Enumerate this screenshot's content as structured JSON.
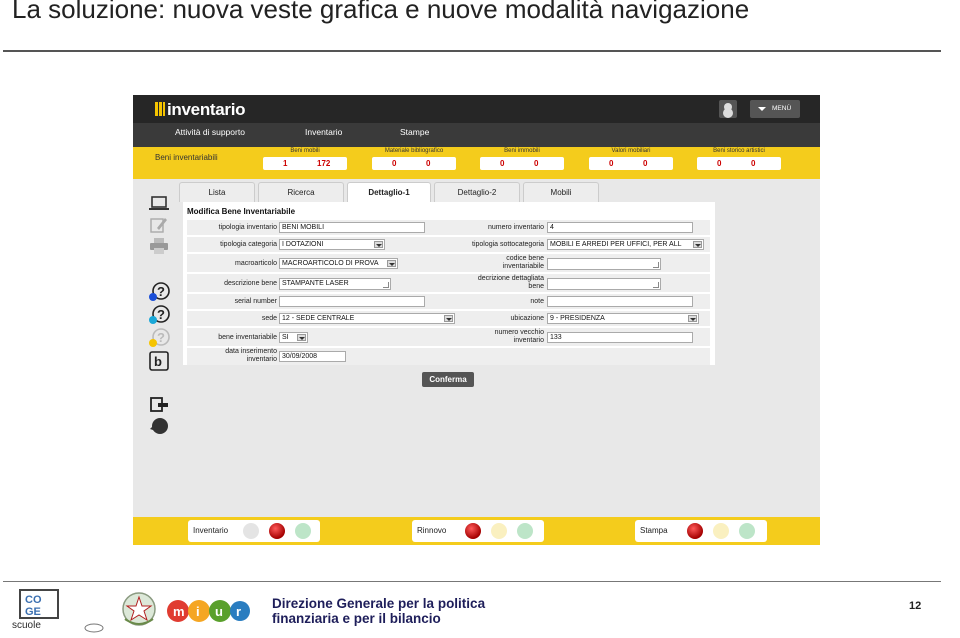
{
  "slide": {
    "title": "La soluzione: nuova veste grafica e nuove modalità navigazione",
    "footer_line1": "Direzione Generale per la politica",
    "footer_line2": "finanziaria e per il bilancio",
    "page_number": "12",
    "coge_logo_text": "scuole"
  },
  "app": {
    "logo": "inventario",
    "menu_label": "MENÙ",
    "nav": [
      "Attività di supporto",
      "Inventario",
      "Stampe"
    ],
    "summary_label": "Beni inventariabili",
    "summary": [
      {
        "label": "Beni mobili",
        "v1": "1",
        "v2": "172"
      },
      {
        "label": "Materiale bibliografico",
        "v1": "0",
        "v2": "0"
      },
      {
        "label": "Beni immobili",
        "v1": "0",
        "v2": "0"
      },
      {
        "label": "Valori mobiliari",
        "v1": "0",
        "v2": "0"
      },
      {
        "label": "Beni storico artistici",
        "v1": "0",
        "v2": "0"
      }
    ],
    "tabs": [
      "Lista",
      "Ricerca",
      "Dettaglio-1",
      "Dettaglio-2",
      "Mobili"
    ],
    "active_tab": "Dettaglio-1",
    "form": {
      "title": "Modifica Bene Inventariabile",
      "tipologia_inventario_label": "tipologia inventario",
      "tipologia_inventario": "BENI MOBILI",
      "numero_inventario_label": "numero inventario",
      "numero_inventario": "4",
      "tipologia_categoria_label": "tipologia categoria",
      "tipologia_categoria": "I DOTAZIONI",
      "tipologia_sottocategoria_label": "tipologia sottocategoria",
      "tipologia_sottocategoria": "MOBILI E ARREDI PER UFFICI, PER ALL",
      "macroarticolo_label": "macroarticolo",
      "macroarticolo": "MACROARTICOLO DI PROVA",
      "codice_bene_label_1": "codice bene",
      "codice_bene_label_2": "inventariabile",
      "codice_bene": "",
      "descrizione_bene_label": "descrizione bene",
      "descrizione_bene": "STAMPANTE LASER",
      "descr_dett_label_1": "decrizione dettagliata",
      "descr_dett_label_2": "bene",
      "descr_dett": "",
      "serial_number_label": "serial number",
      "serial_number": "",
      "note_label": "note",
      "note": "",
      "sede_label": "sede",
      "sede": "12 - SEDE CENTRALE",
      "ubicazione_label": "ubicazione",
      "ubicazione": "9 - PRESIDENZA",
      "bene_inv_label": "bene inventariabile",
      "bene_inv": "SI",
      "numero_vecchio_label_1": "numero vecchio",
      "numero_vecchio_label_2": "inventario",
      "numero_vecchio": "133",
      "data_label_1": "data inserimento",
      "data_label_2": "inventario",
      "data_inserimento": "30/09/2008",
      "confirm_label": "Conferma"
    },
    "status": [
      {
        "label": "Inventario",
        "dots": [
          "grey",
          "red",
          "green"
        ]
      },
      {
        "label": "Rinnovo",
        "dots": [
          "red",
          "yellow",
          "green"
        ]
      },
      {
        "label": "Stampa",
        "dots": [
          "red",
          "yellow",
          "green"
        ]
      }
    ],
    "side_icons": [
      "monitor-icon",
      "edit-icon",
      "print-icon",
      "help-blue-icon",
      "help-cyan-icon",
      "help-yellow-icon",
      "bold-b-icon",
      "exit-icon",
      "globe-refresh-icon"
    ]
  }
}
